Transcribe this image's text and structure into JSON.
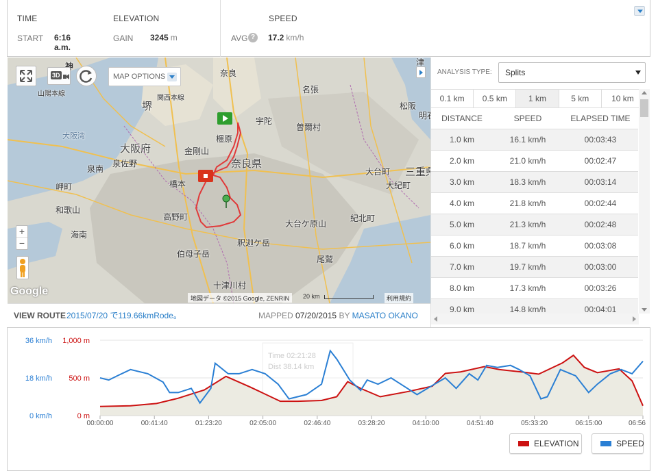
{
  "stats": {
    "time": {
      "header": "TIME",
      "label": "START",
      "value": "6:16 a.m."
    },
    "elevation": {
      "header": "ELEVATION",
      "label": "GAIN",
      "value": "3245",
      "unit": "m"
    },
    "speed": {
      "header": "SPEED",
      "label": "AVG",
      "help": "?",
      "value": "17.2",
      "unit": "km/h"
    }
  },
  "map": {
    "options_label": "MAP OPTIONS",
    "badge_3d": "3D",
    "zoom_in": "+",
    "zoom_out": "−",
    "google": "Google",
    "attribution": "地図データ ©2015 Google, ZENRIN",
    "scale": "20 km",
    "terms": "利用規約",
    "labels": [
      {
        "text": "奈良"
      },
      {
        "text": "山陽本線"
      },
      {
        "text": "関西本線"
      },
      {
        "text": "名張"
      },
      {
        "text": "松阪"
      },
      {
        "text": "堺"
      },
      {
        "text": "宇陀"
      },
      {
        "text": "曽爾村"
      },
      {
        "text": "大阪湾"
      },
      {
        "text": "大阪府"
      },
      {
        "text": "金剛山"
      },
      {
        "text": "橿原"
      },
      {
        "text": "奈良県"
      },
      {
        "text": "泉南"
      },
      {
        "text": "泉佐野"
      },
      {
        "text": "岬町"
      },
      {
        "text": "橋本"
      },
      {
        "text": "大台町"
      },
      {
        "text": "三重県"
      },
      {
        "text": "大紀町"
      },
      {
        "text": "和歌山"
      },
      {
        "text": "高野町"
      },
      {
        "text": "紀北町"
      },
      {
        "text": "大台ケ原山"
      },
      {
        "text": "海南"
      },
      {
        "text": "釈迦ケ岳"
      },
      {
        "text": "伯母子岳"
      },
      {
        "text": "尾鷲"
      },
      {
        "text": "十津川村"
      },
      {
        "text": "明石"
      },
      {
        "text": "神"
      },
      {
        "text": "津"
      }
    ]
  },
  "route": {
    "view_label": "VIEW ROUTE",
    "title": "2015/07/20 で119.66kmRode。",
    "mapped_label": "MAPPED",
    "mapped_date": "07/20/2015",
    "by_label": "BY",
    "user": "MASATO OKANO"
  },
  "analysis": {
    "type_label": "ANALYSIS TYPE:",
    "type_value": "Splits",
    "tabs": [
      "0.1 km",
      "0.5 km",
      "1 km",
      "5 km",
      "10 km"
    ],
    "active_tab": "1 km",
    "columns": [
      "DISTANCE",
      "SPEED",
      "ELAPSED TIME"
    ],
    "rows": [
      [
        "1.0 km",
        "16.1 km/h",
        "00:03:43"
      ],
      [
        "2.0 km",
        "21.0 km/h",
        "00:02:47"
      ],
      [
        "3.0 km",
        "18.3 km/h",
        "00:03:14"
      ],
      [
        "4.0 km",
        "21.8 km/h",
        "00:02:44"
      ],
      [
        "5.0 km",
        "21.3 km/h",
        "00:02:48"
      ],
      [
        "6.0 km",
        "18.7 km/h",
        "00:03:08"
      ],
      [
        "7.0 km",
        "19.7 km/h",
        "00:03:00"
      ],
      [
        "8.0 km",
        "17.3 km/h",
        "00:03:26"
      ],
      [
        "9.0 km",
        "14.8 km/h",
        "00:04:01"
      ]
    ]
  },
  "chart_data": {
    "type": "line",
    "speed_ticks": [
      "36 km/h",
      "18 km/h",
      "0 km/h"
    ],
    "elev_ticks": [
      "1,000 m",
      "500 m",
      "0 m"
    ],
    "speed_range": [
      0,
      36
    ],
    "elev_range": [
      0,
      1000
    ],
    "x_ticks": [
      "00:00:00",
      "00:41:40",
      "01:23:20",
      "02:05:00",
      "02:46:40",
      "03:28:20",
      "04:10:00",
      "04:51:40",
      "05:33:20",
      "06:15:00",
      "06:56"
    ],
    "x_range_seconds": [
      0,
      25000
    ],
    "tooltip_ghost": [
      "Time 02:21:28",
      "Dist 38.14 km"
    ],
    "series": [
      {
        "name": "ELEVATION",
        "color": "#cc1111",
        "fill": "#ecebe2",
        "x": [
          0,
          1400,
          2600,
          3600,
          4800,
          5800,
          6900,
          8300,
          9100,
          10200,
          10900,
          11400,
          12000,
          12900,
          14200,
          15300,
          15900,
          16600,
          17700,
          18400,
          19400,
          20200,
          21300,
          21800,
          22300,
          22900,
          23900,
          24500,
          25000
        ],
        "values": [
          120,
          130,
          160,
          230,
          340,
          520,
          380,
          190,
          190,
          200,
          250,
          450,
          360,
          250,
          320,
          390,
          560,
          580,
          650,
          610,
          580,
          550,
          700,
          800,
          640,
          570,
          620,
          460,
          130
        ]
      },
      {
        "name": "SPEED",
        "color": "#2a7fd4",
        "x": [
          0,
          400,
          800,
          1400,
          2200,
          2900,
          3200,
          3600,
          4200,
          4600,
          5100,
          5300,
          5900,
          6400,
          7000,
          7600,
          8200,
          8700,
          9500,
          10200,
          10600,
          10900,
          11500,
          12000,
          12300,
          12800,
          13400,
          14000,
          14600,
          15400,
          15900,
          16400,
          17000,
          17400,
          17800,
          18300,
          18900,
          19300,
          19800,
          20300,
          20600,
          21200,
          21900,
          22500,
          22900,
          23500,
          24000,
          24500,
          25000
        ],
        "values": [
          18,
          17,
          19,
          22,
          20,
          16,
          11,
          11,
          13,
          6,
          13,
          25,
          20,
          20,
          22,
          20,
          15,
          8,
          10,
          15,
          31,
          27,
          17,
          12,
          17,
          15,
          18,
          14,
          10,
          15,
          18,
          13,
          20,
          17,
          24,
          23,
          24,
          22,
          19,
          8,
          9,
          22,
          19,
          11,
          15,
          20,
          22,
          20,
          26
        ]
      }
    ]
  },
  "legend": {
    "elevation": "ELEVATION",
    "speed": "SPEED"
  }
}
